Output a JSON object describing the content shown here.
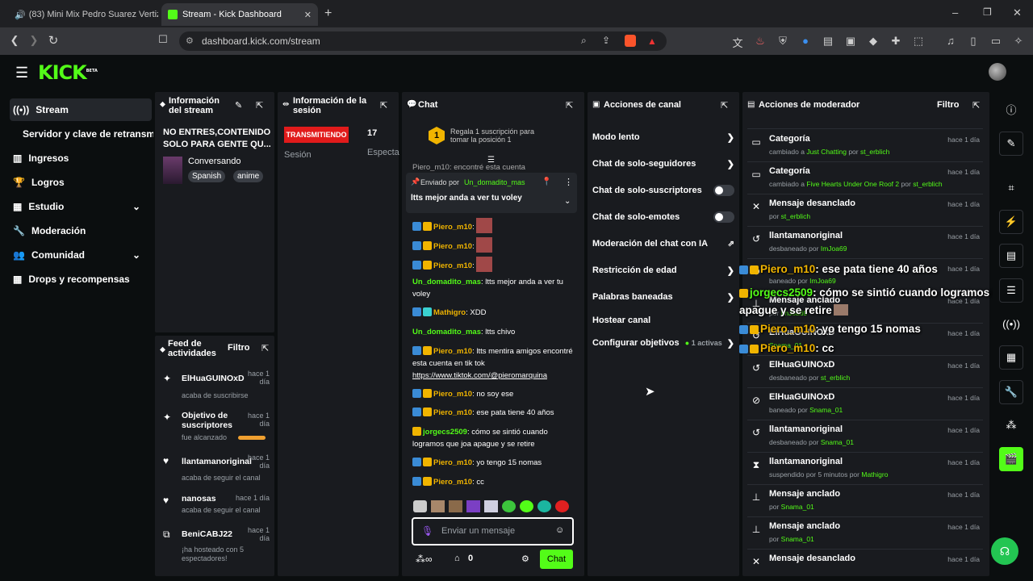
{
  "browser": {
    "tabs": [
      {
        "title": "(83) Mini Mix Pedro Suarez Vertiz",
        "icon": "youtube-icon"
      },
      {
        "title": "Stream - Kick Dashboard",
        "icon": "kick-icon"
      }
    ],
    "url": "dashboard.kick.com/stream"
  },
  "brand": {
    "logo": "KICK",
    "beta": "BETA",
    "accent": "#53fc18"
  },
  "sidebar": {
    "items": [
      {
        "label": "Stream",
        "icon": "broadcast-icon",
        "active": true
      },
      {
        "label": "Servidor y clave de retransm",
        "icon": ""
      },
      {
        "label": "Ingresos",
        "icon": "chart-icon"
      },
      {
        "label": "Logros",
        "icon": "trophy-icon"
      },
      {
        "label": "Estudio",
        "icon": "layers-icon",
        "expand": true
      },
      {
        "label": "Moderación",
        "icon": "wrench-icon"
      },
      {
        "label": "Comunidad",
        "icon": "people-icon",
        "expand": true
      },
      {
        "label": "Drops y recompensas",
        "icon": "gift-icon"
      }
    ]
  },
  "stream_info": {
    "title": "Información del stream",
    "stream_title": "NO ENTRES,CONTENIDO SOLO PARA GENTE QU...",
    "category": "Conversando",
    "tags": [
      "Spanish",
      "anime"
    ]
  },
  "session_info": {
    "title": "Información de la sesión",
    "status": "TRANSMITIENDO",
    "viewers": "17",
    "session_label": "Sesión",
    "viewers_label": "Especta"
  },
  "activity_feed": {
    "title": "Feed de actividades",
    "filter": "Filtro",
    "items": [
      {
        "user": "ElHuaGUINOxD",
        "desc": "acaba de suscribirse",
        "time": "hace 1 día",
        "icon": "star-icon"
      },
      {
        "user": "Objetivo de suscriptores",
        "desc": "fue alcanzado",
        "time": "hace 1 día",
        "icon": "star-icon",
        "progress": 1.0
      },
      {
        "user": "llantamanoriginal",
        "desc": "acaba de seguir el canal",
        "time": "hace 1 día",
        "icon": "heart-icon"
      },
      {
        "user": "nanosas",
        "desc": "acaba de seguir el canal",
        "time": "hace 1 día",
        "icon": "heart-icon"
      },
      {
        "user": "BeniCABJ22",
        "desc": "¡ha hosteado con 5 espectadores!",
        "time": "hace 1 día",
        "icon": "host-icon"
      }
    ]
  },
  "chat": {
    "title": "Chat",
    "gift_prompt": "Regala 1 suscripción para tomar la posición 1",
    "gift_rank": "1",
    "truncated_line": "Piero_m10: encontré esta cuenta",
    "pinned": {
      "label": "Enviado por",
      "user": "Un_domadito_mas",
      "text": "ltts mejor anda a ver tu voley"
    },
    "messages": [
      {
        "user": "Piero_m10",
        "text": "",
        "badges": [
          "v",
          "c"
        ],
        "emote": true
      },
      {
        "user": "Piero_m10",
        "text": "",
        "badges": [
          "v",
          "c"
        ],
        "emote": true
      },
      {
        "user": "Piero_m10",
        "text": "",
        "badges": [
          "v",
          "c"
        ],
        "emote": true
      },
      {
        "user": "Un_domadito_mas",
        "text": "ltts mejor anda a ver tu voley",
        "badges": []
      },
      {
        "user": "Mathigro",
        "text": "XDD",
        "badges": [
          "v",
          "c"
        ]
      },
      {
        "user": "Un_domadito_mas",
        "text": "ltts chivo",
        "badges": []
      },
      {
        "user": "Piero_m10",
        "text": "ltts mentira amigos encontré esta cuenta en tik tok",
        "link": "https://www.tiktok.com/@pieromarquina",
        "badges": [
          "v",
          "c"
        ]
      },
      {
        "user": "Piero_m10",
        "text": "no soy ese",
        "badges": [
          "v",
          "c"
        ]
      },
      {
        "user": "Piero_m10",
        "text": "ese pata tiene 40 años",
        "badges": [
          "v",
          "c"
        ]
      },
      {
        "user": "jorgecs2509",
        "text": "cómo se sintió cuando logramos que joa apague y se retire",
        "badges": [
          "c"
        ]
      },
      {
        "user": "Piero_m10",
        "text": "yo tengo 15 nomas",
        "badges": [
          "v",
          "c"
        ]
      },
      {
        "user": "Piero_m10",
        "text": "cc",
        "badges": [
          "v",
          "c"
        ]
      }
    ],
    "input_placeholder": "Enviar un mensaje",
    "points": "0",
    "send_label": "Chat"
  },
  "channel_actions": {
    "title": "Acciones de canal",
    "items": [
      {
        "label": "Modo lento",
        "control": "chevron"
      },
      {
        "label": "Chat de solo-seguidores",
        "control": "chevron"
      },
      {
        "label": "Chat de solo-suscriptores",
        "control": "toggle"
      },
      {
        "label": "Chat de solo-emotes",
        "control": "toggle"
      },
      {
        "label": "Moderación del chat con IA",
        "control": "external"
      },
      {
        "label": "Restricción de edad",
        "control": "chevron"
      },
      {
        "label": "Palabras baneadas",
        "control": "chevron"
      },
      {
        "label": "Hostear canal",
        "control": "none"
      },
      {
        "label": "Configurar objetivos",
        "control": "chevron",
        "badge": "1 activas"
      }
    ]
  },
  "mod_actions": {
    "title": "Acciones de moderador",
    "filter": "Filtro",
    "items": [
      {
        "title": "Categoría",
        "sub_pre": "cambiado a",
        "highlight": "Just Chatting",
        "sub_mid": "por",
        "actor": "st_erblich",
        "time": "hace 1 día",
        "icon": "category-icon"
      },
      {
        "title": "Categoría",
        "sub_pre": "cambiado a",
        "highlight": "Five Hearts Under One Roof 2",
        "sub_mid": "por",
        "actor": "st_erblich",
        "time": "hace 1 día",
        "icon": "category-icon"
      },
      {
        "title": "Mensaje desanclado",
        "sub_pre": "por",
        "highlight": "",
        "sub_mid": "",
        "actor": "st_erblich",
        "time": "hace 1 día",
        "icon": "unpin-icon"
      },
      {
        "title": "llantamanoriginal",
        "sub_pre": "desbaneado por",
        "highlight": "",
        "sub_mid": "",
        "actor": "ImJoa69",
        "time": "hace 1 día",
        "icon": "unban-icon"
      },
      {
        "title": "",
        "sub_pre": "baneado por",
        "highlight": "",
        "sub_mid": "",
        "actor": "ImJoa69",
        "time": "hace 1 día",
        "icon": "ban-icon"
      },
      {
        "title": "Mensaje anclado",
        "sub_pre": "por",
        "highlight": "",
        "sub_mid": "",
        "actor": "ImJoa69",
        "time": "hace 1 día",
        "icon": "pin-icon"
      },
      {
        "title": "ElHuaGUINOxD",
        "sub_pre": "",
        "highlight": "",
        "sub_mid": "",
        "actor": "Snama_01",
        "time": "hace 1 día",
        "icon": "unban-icon"
      },
      {
        "title": "ElHuaGUINOxD",
        "sub_pre": "desbaneado por",
        "highlight": "",
        "sub_mid": "",
        "actor": "st_erblich",
        "time": "hace 1 día",
        "icon": "unban-icon"
      },
      {
        "title": "ElHuaGUINOxD",
        "sub_pre": "baneado por",
        "highlight": "",
        "sub_mid": "",
        "actor": "Snama_01",
        "time": "hace 1 día",
        "icon": "ban-icon"
      },
      {
        "title": "llantamanoriginal",
        "sub_pre": "desbaneado por",
        "highlight": "",
        "sub_mid": "",
        "actor": "Snama_01",
        "time": "hace 1 día",
        "icon": "unban-icon"
      },
      {
        "title": "llantamanoriginal",
        "sub_pre": "suspendido por 5 minutos por",
        "highlight": "",
        "sub_mid": "",
        "actor": "Mathigro",
        "time": "hace 1 día",
        "icon": "hourglass-icon"
      },
      {
        "title": "Mensaje anclado",
        "sub_pre": "por",
        "highlight": "",
        "sub_mid": "",
        "actor": "Snama_01",
        "time": "hace 1 día",
        "icon": "pin-icon"
      },
      {
        "title": "Mensaje anclado",
        "sub_pre": "por",
        "highlight": "",
        "sub_mid": "",
        "actor": "Snama_01",
        "time": "hace 1 día",
        "icon": "pin-icon"
      },
      {
        "title": "Mensaje desanclado",
        "sub_pre": "",
        "highlight": "",
        "sub_mid": "",
        "actor": "",
        "time": "hace 1 día",
        "icon": "unpin-icon"
      }
    ]
  },
  "overlay": [
    {
      "user": "Piero_m10",
      "text": ": ese pata tiene 40 años"
    },
    {
      "user": "jorgecs2509",
      "text": ": cómo se sintió cuando logramos que joa apague y se retire"
    },
    {
      "user": "Piero_m10",
      "text": ": yo tengo 15 nomas"
    },
    {
      "user": "Piero_m10",
      "text": ": cc"
    }
  ]
}
